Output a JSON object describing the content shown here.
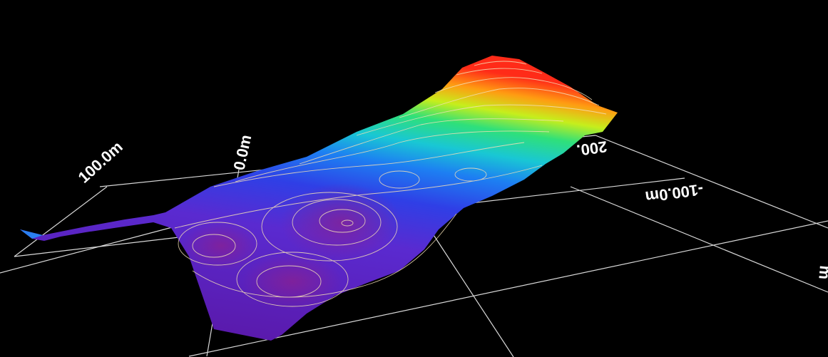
{
  "scene": {
    "background": "#000000",
    "grid_color": "#d8d8d8",
    "contour_color": "#f3dfb6",
    "colormap": [
      "#6a1fb8",
      "#3a30e0",
      "#1f8cf0",
      "#19d2c6",
      "#2fe07a",
      "#c8f019",
      "#ff9a10",
      "#ff2a1a"
    ]
  },
  "axis_labels": {
    "x_left": "100.0m",
    "x_center": "0.0m",
    "x_right": "-100.0m",
    "corner": "200.",
    "edge": "m"
  }
}
